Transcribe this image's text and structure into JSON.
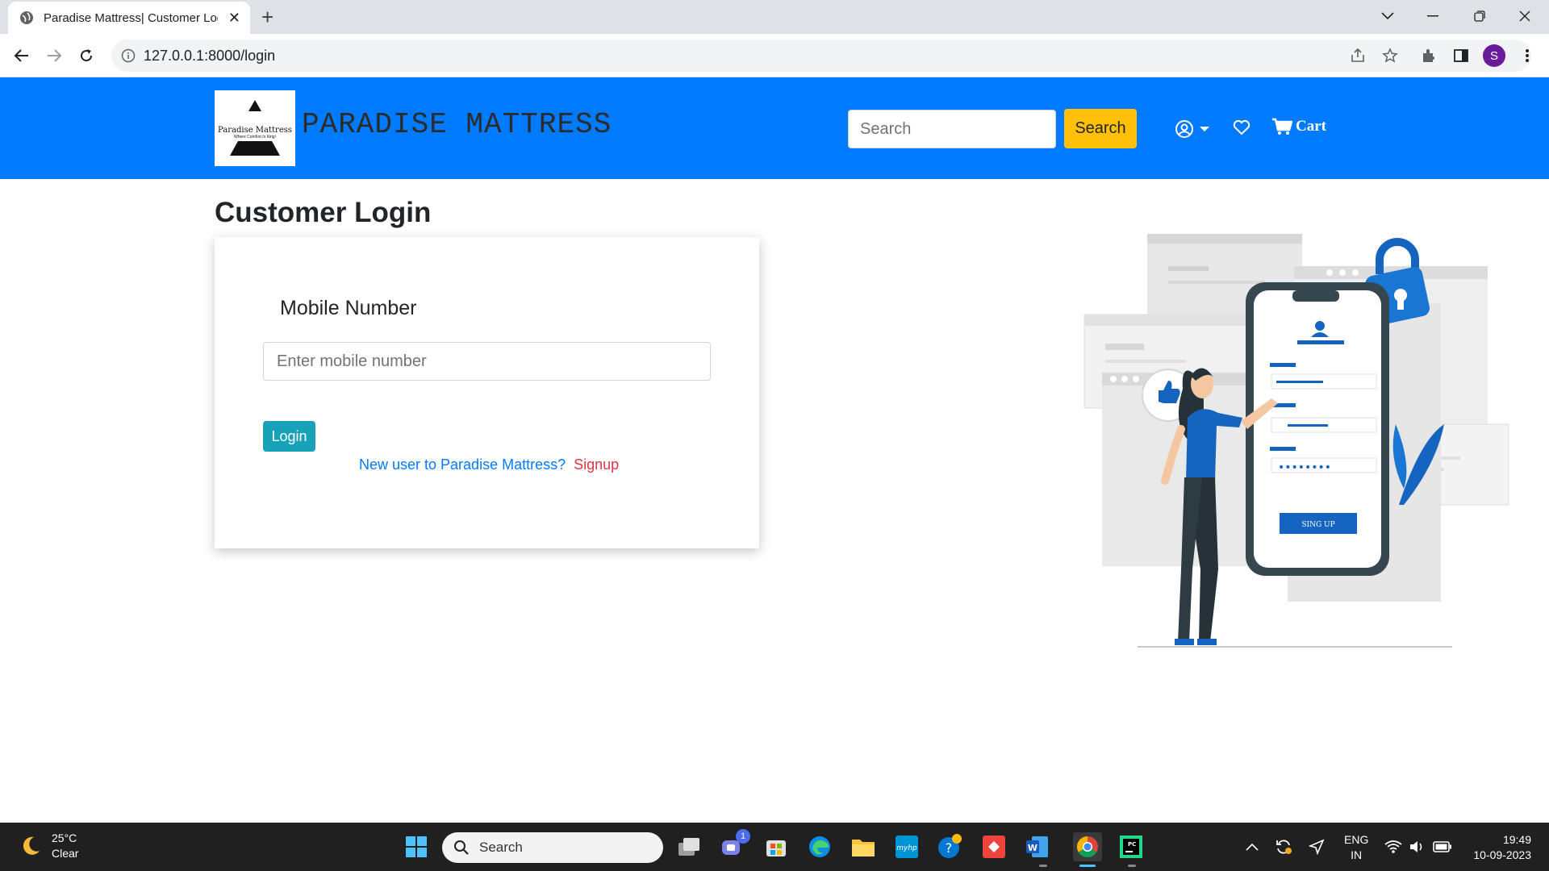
{
  "browser": {
    "tab_title": "Paradise Mattress| Customer Log",
    "url": "127.0.0.1:8000/login",
    "profile_initial": "S"
  },
  "header": {
    "logo_text": "Paradise Mattress",
    "logo_tagline": "Where Comfort Is King!",
    "brand": "PARADISE MATTRESS",
    "search_placeholder": "Search",
    "search_button": "Search",
    "cart_label": "Cart"
  },
  "main": {
    "title": "Customer Login",
    "mobile_label": "Mobile Number",
    "mobile_placeholder": "Enter mobile number",
    "login_button": "Login",
    "new_user_text": "New user to Paradise Mattress?",
    "signup_link": "Signup",
    "illustration_button_text": "SING UP",
    "illustration_password_dots": "••••••••"
  },
  "taskbar": {
    "weather_temp": "25°C",
    "weather_desc": "Clear",
    "search_label": "Search",
    "teams_badge": "1",
    "lang_line1": "ENG",
    "lang_line2": "IN",
    "time": "19:49",
    "date": "10-09-2023"
  },
  "colors": {
    "header_bg": "#007bff",
    "search_button_bg": "#ffc107",
    "login_button_bg": "#17a2b8",
    "signup_link": "#dc3545",
    "new_user_link": "#007bff"
  }
}
